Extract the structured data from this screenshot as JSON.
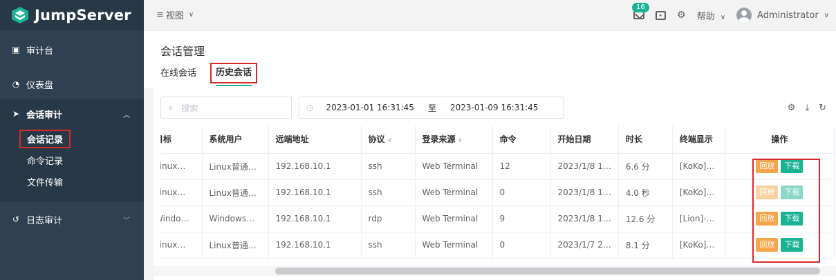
{
  "app": {
    "logo_text": "JumpServer"
  },
  "sidebar": {
    "items": [
      {
        "label": "审计台",
        "icon": "clipboard-icon"
      },
      {
        "label": "仪表盘",
        "icon": "dashboard-icon"
      }
    ],
    "session_group": {
      "label": "会话审计",
      "icon": "send-icon",
      "sub_items": [
        {
          "label": "会话记录",
          "active": true
        },
        {
          "label": "命令记录"
        },
        {
          "label": "文件传输"
        }
      ]
    },
    "log_audit": {
      "label": "日志审计",
      "icon": "history-icon"
    }
  },
  "topbar": {
    "view_label": "视图",
    "mail_badge": "16",
    "help_label": "帮助",
    "user_name": "Administrator"
  },
  "page": {
    "title": "会话管理",
    "tabs": [
      {
        "label": "在线会话"
      },
      {
        "label": "历史会话",
        "active": true
      }
    ]
  },
  "toolbar": {
    "search_placeholder": "搜索",
    "date_from": "2023-01-01 16:31:45",
    "date_sep": "至",
    "date_to": "2023-01-09 16:31:45"
  },
  "table": {
    "columns": [
      "目标",
      "系统用户",
      "远端地址",
      "协议",
      "登录来源",
      "命令",
      "开始日期",
      "时长",
      "终端显示",
      "操作"
    ],
    "rows": [
      {
        "target": "Linux…",
        "sysuser": "Linux普通…",
        "remote": "192.168.10.1",
        "protocol": "ssh",
        "source": "Web Terminal",
        "commands": "12",
        "start": "2023/1/8 1…",
        "duration": "6.6 分",
        "terminal": "[KoKo]…",
        "ops_enabled": true
      },
      {
        "target": "Linux…",
        "sysuser": "Linux普通…",
        "remote": "192.168.10.1",
        "protocol": "ssh",
        "source": "Web Terminal",
        "commands": "0",
        "start": "2023/1/8 1…",
        "duration": "4.0 秒",
        "terminal": "[KoKo]…",
        "ops_enabled": false
      },
      {
        "target": "Windo…",
        "sysuser": "Windows…",
        "remote": "192.168.10.1",
        "protocol": "rdp",
        "source": "Web Terminal",
        "commands": "9",
        "start": "2023/1/8 1…",
        "duration": "12.6 分",
        "terminal": "[Lion]-…",
        "ops_enabled": true
      },
      {
        "target": "Linux…",
        "sysuser": "Linux普通…",
        "remote": "192.168.10.1",
        "protocol": "ssh",
        "source": "Web Terminal",
        "commands": "0",
        "start": "2023/1/7 2…",
        "duration": "8.1 分",
        "terminal": "[KoKo]…",
        "ops_enabled": true
      }
    ],
    "replay_label": "回放",
    "download_label": "下载"
  },
  "colors": {
    "accent": "#1ab394",
    "sidebar": "#2f4050",
    "replay": "#f7a54a",
    "highlight": "#d42a2a"
  }
}
